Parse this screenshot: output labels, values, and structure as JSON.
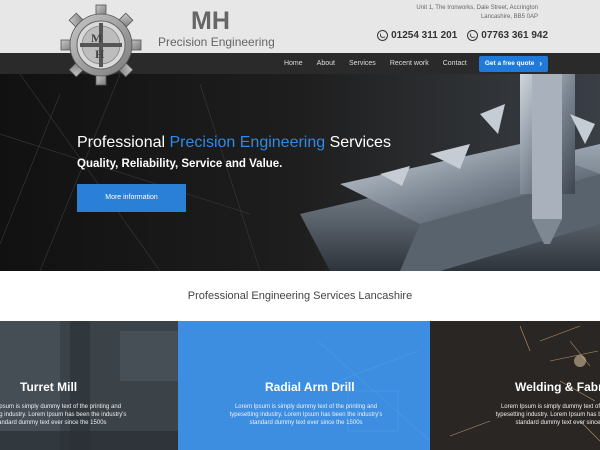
{
  "brand": {
    "initials": "MH",
    "name": "Precision Engineering"
  },
  "contact": {
    "address_line1": "Unit 1, The Ironworks, Dale Street, Accrington",
    "address_line2": "Lancashire, BB5 0AP",
    "phone1": "01254 311 201",
    "phone2": "07763 361 942"
  },
  "nav": {
    "items": [
      "Home",
      "About",
      "Services",
      "Recent work",
      "Contact"
    ],
    "quote_label": "Get a free quote"
  },
  "hero": {
    "title_part1": "Professional ",
    "title_accent": "Precision Engineering",
    "title_part2": " Services",
    "subtitle": "Quality, Reliability, Service and Value.",
    "button_label": "More information"
  },
  "services": {
    "heading": "Professional Engineering Services Lancashire",
    "cards": [
      {
        "title": "Turret Mill",
        "text": "Lorem Ipsum is simply dummy text of the printing and typesetting industry. Lorem Ipsum has been the industry's standard dummy text ever since the 1500s"
      },
      {
        "title": "Radial Arm Drill",
        "text": "Lorem Ipsum is simply dummy text of the printing and typesetting industry. Lorem Ipsum has been the industry's standard dummy text ever since the 1500s"
      },
      {
        "title": "Welding & Fabrica",
        "text": "Lorem Ipsum is simply dummy text of the printing and typesetting industry. Lorem Ipsum has been the industry's standard dummy text ever since the 1500s"
      }
    ]
  },
  "colors": {
    "accent": "#2a7fd7",
    "header_bg": "#e7e7e7",
    "nav_bg": "#2a2a2a"
  }
}
